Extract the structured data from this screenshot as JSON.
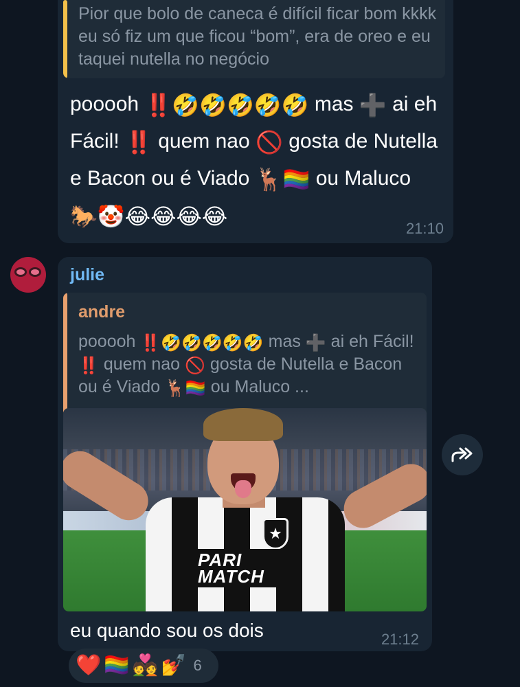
{
  "message_1": {
    "quote_text": "Pior que bolo de caneca é difícil ficar bom kkkk eu só fiz um que ficou “bom”, era de oreo e eu taquei nutella no negócio",
    "text_parts": {
      "t1": "pooooh",
      "e1": "‼️",
      "e2": "🤣🤣🤣🤣🤣",
      "t2": "mas",
      "e3": "➕",
      "t3": "ai eh Fácil!",
      "e4": "‼️",
      "t4": "quem nao",
      "e5": "🚫",
      "t5": "gosta de Nutella e Bacon ou é Viado",
      "e6": "🦌🏳️‍🌈",
      "t6": "ou Maluco",
      "e7": "🐎🤡😂😂😂😂"
    },
    "time": "21:10"
  },
  "message_2": {
    "sender": "julie",
    "quote_author": "andre",
    "quote_parts": {
      "t1": "pooooh",
      "e1": "‼️🤣🤣🤣🤣🤣",
      "t2": "mas",
      "e2": "➕",
      "t3": "ai eh Fácil!",
      "e3": "‼️",
      "t4": "quem nao",
      "e4": "🚫",
      "t5": "gosta de Nutella e Bacon ou é Viado",
      "e5": "🦌🏳️‍🌈",
      "t6": "ou Maluco ..."
    },
    "photo_sponsor": "PARI MATCH",
    "text": "eu quando sou os dois",
    "time": "21:12"
  },
  "reactions": {
    "emojis": [
      "❤️",
      "🏳️‍🌈",
      "💑",
      "💅"
    ],
    "count": "6"
  },
  "colors": {
    "background": "#0e1621",
    "bubble": "#182533",
    "sender": "#71baf6",
    "quote_1_bar": "#f3c04a",
    "quote_2_bar": "#e8a06e"
  }
}
